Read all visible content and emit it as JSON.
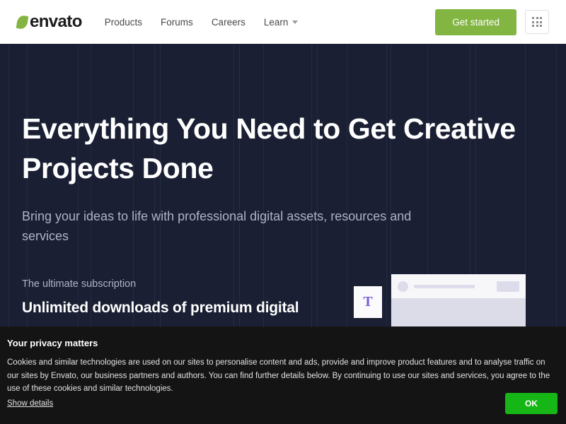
{
  "header": {
    "logo_text": "envato",
    "logo_icon": "leaf-icon",
    "nav": [
      {
        "label": "Products",
        "has_dropdown": false
      },
      {
        "label": "Forums",
        "has_dropdown": false
      },
      {
        "label": "Careers",
        "has_dropdown": false
      },
      {
        "label": "Learn",
        "has_dropdown": true
      }
    ],
    "cta_label": "Get started",
    "apps_icon": "grid-apps-icon"
  },
  "hero": {
    "heading": "Everything You Need to Get Creative Projects Done",
    "subheading": "Bring your ideas to life with professional digital assets, resources and services",
    "eyebrow": "The ultimate subscription",
    "promo": "Unlimited downloads of premium digital",
    "illustration": {
      "tile_letter": "T",
      "tile_icon": "text-tool-icon",
      "card_icon": "browser-card-illustration",
      "accent_icon": "teal-accent-bar"
    }
  },
  "cookie_banner": {
    "title": "Your privacy matters",
    "body": "Cookies and similar technologies are used on our sites to personalise content and ads, provide and improve product features and to analyse traffic on our sites by Envato, our business partners and authors. You can find further details below. By continuing to use our sites and services, you agree to the use of these cookies and similar technologies.",
    "show_details_label": "Show details",
    "accept_label": "OK"
  },
  "colors": {
    "brand_green": "#82b541",
    "hero_bg": "#1a1f33",
    "banner_bg": "#141414",
    "accept_green": "#16b616",
    "teal_accent": "#3dc9ae",
    "purple_t": "#7c5cd6"
  }
}
